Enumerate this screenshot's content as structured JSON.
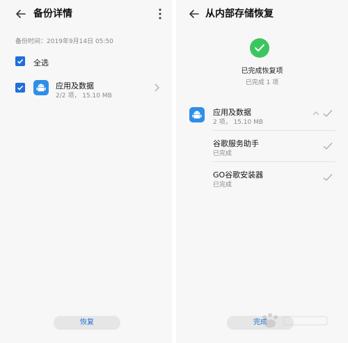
{
  "left": {
    "header": {
      "title": "备份详情",
      "back_icon": "arrow-left-icon",
      "more_icon": "more-vertical-icon"
    },
    "backup_time": "备份时间：2019年9月14日 05:50",
    "select_all": {
      "label": "全选",
      "checked": true
    },
    "items": [
      {
        "title": "应用及数据",
        "subtitle": "2/2 项， 15.10 MB",
        "checked": true,
        "icon": "android-icon"
      }
    ],
    "button_label": "恢复"
  },
  "right": {
    "header": {
      "title": "从内部存储恢复",
      "back_icon": "arrow-left-icon"
    },
    "status": {
      "icon": "check-circle-icon",
      "title": "已完成恢复项",
      "subtitle": "已完成 1 项"
    },
    "group": {
      "title": "应用及数据",
      "subtitle": "2 项， 15.10 MB",
      "icon": "android-icon"
    },
    "sub_items": [
      {
        "title": "谷歌服务助手",
        "status": "已完成"
      },
      {
        "title": "GO谷歌安装器",
        "status": "已完成"
      }
    ],
    "button_label": "完成"
  },
  "colors": {
    "accent": "#1e6fd9",
    "success": "#3cc55f",
    "android_icon_bg": "#2f8ee8"
  }
}
